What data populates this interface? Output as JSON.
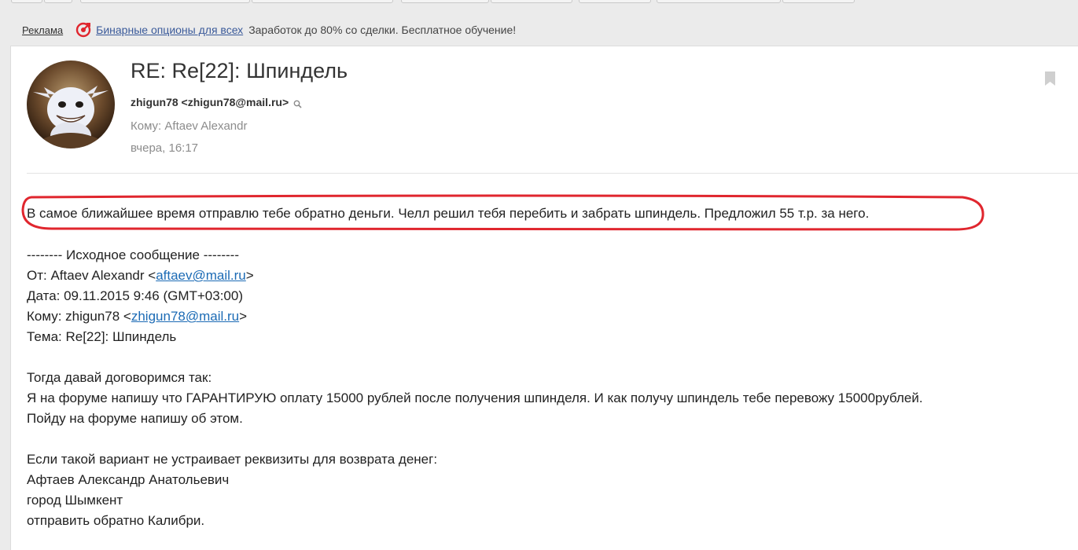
{
  "ad": {
    "label": "Реклама",
    "link": "Бинарные опционы для всех",
    "text": "Заработок до 80% со сделки. Бесплатное обучение!"
  },
  "message": {
    "subject": "RE: Re[22]: Шпиндель",
    "from": "zhigun78 <zhigun78@mail.ru>",
    "to": "Кому: Aftaev Alexandr",
    "date": "вчера, 16:17",
    "highlighted": "В самое ближайшее время отправлю тебе обратно деньги. Челл решил тебя перебить и забрать шпиндель. Предложил 55 т.р. за него."
  },
  "quoted": {
    "separator": "-------- Исходное сообщение --------",
    "from_prefix": "От: Aftaev Alexandr <",
    "from_email": "aftaev@mail.ru",
    "from_suffix": ">",
    "date": "Дата: 09.11.2015 9:46 (GMT+03:00)",
    "to_prefix": "Кому: zhigun78 <",
    "to_email": "zhigun78@mail.ru",
    "to_suffix": ">",
    "subject": "Тема: Re[22]: Шпиндель",
    "p1_l1": "Тогда давай договоримся так:",
    "p1_l2": "Я на форуме напишу что ГАРАНТИРУЮ оплату 15000 рублей после получения шпинделя. И как получу шпиндель тебе перевожу 15000рублей.",
    "p1_l3": "Пойду на форуме напишу об этом.",
    "p2_l1": "Если такой вариант не устраивает реквизиты для возврата денег:",
    "p2_l2": "Афтаев Александр Анатольевич",
    "p2_l3": "город Шымкент",
    "p2_l4": "отправить обратно Калибри."
  },
  "colors": {
    "link": "#1c6bb5",
    "highlight_oval": "#e0262e",
    "muted": "#8c8c8c"
  }
}
